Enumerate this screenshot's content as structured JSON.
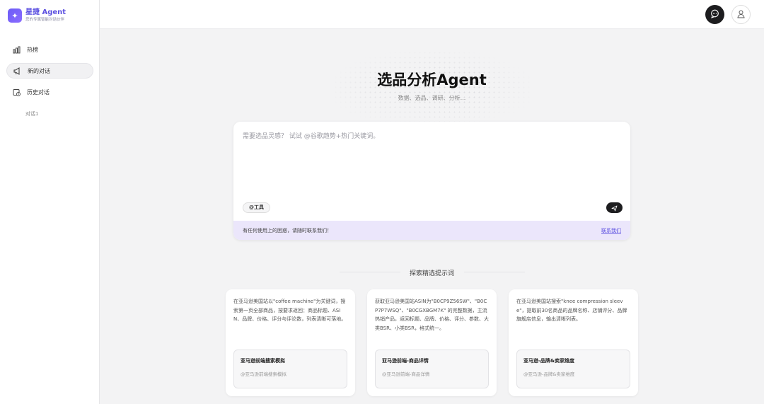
{
  "brand": {
    "title": "星捷 Agent",
    "subtitle": "您的专属智能对话伙伴"
  },
  "sidebar": {
    "items": [
      {
        "label": "热榜",
        "icon": "bar-chart-icon"
      },
      {
        "label": "新的对话",
        "icon": "megaphone-icon",
        "active": true
      },
      {
        "label": "历史对话",
        "icon": "history-icon"
      }
    ],
    "history": [
      "对话1"
    ]
  },
  "topbar": {
    "chat_icon": "chat-bubble-icon",
    "user_icon": "user-icon"
  },
  "hero": {
    "title": "选品分析Agent",
    "subtitle": "数据、选品、调研、分析..."
  },
  "composer": {
    "placeholder": "需要选品灵感？ 试试 @谷歌趋势+热门关键词。",
    "value": "",
    "tool_label": "@工具",
    "footer_text": "有任何使用上的困惑，请随时联系我们！",
    "footer_link": "联系我们"
  },
  "prompts": {
    "heading": "探索精选提示词",
    "cards": [
      {
        "description": "在亚马逊美国站以\"coffee machine\"为关键词，搜索第一页全部商品，按要求返回：商品标题、ASIN、品牌、价格、评分与评论数，列表清晰可落地。",
        "tool_title": "亚马逊前端搜索模拟",
        "tool_sub": "@亚马逊前端搜索模拟"
      },
      {
        "description": "获取亚马逊美国站ASIN为\"B0CP9Z56SW\"、\"B0CP7P7WSQ\"、\"B0CGXBGM7K\" 的完整数据，主流热销产品，返回标题、品牌、价格、评分、参数、大类BSR、小类BSR，格式统一。",
        "tool_title": "亚马逊前端-商品详情",
        "tool_sub": "@亚马逊前端-商品详情"
      },
      {
        "description": "在亚马逊美国站搜索\"knee compression sleeve\"，提取前30名商品的品牌名称、店铺评分、品牌旗舰店信息，输出清晰列表。",
        "tool_title": "亚马逊-品牌&卖家维度",
        "tool_sub": "@亚马逊-品牌&卖家维度"
      }
    ]
  },
  "colors": {
    "accent": "#5b4fe0",
    "footer_bg": "#ebe6fb",
    "dark_button": "#1d1d1f"
  }
}
